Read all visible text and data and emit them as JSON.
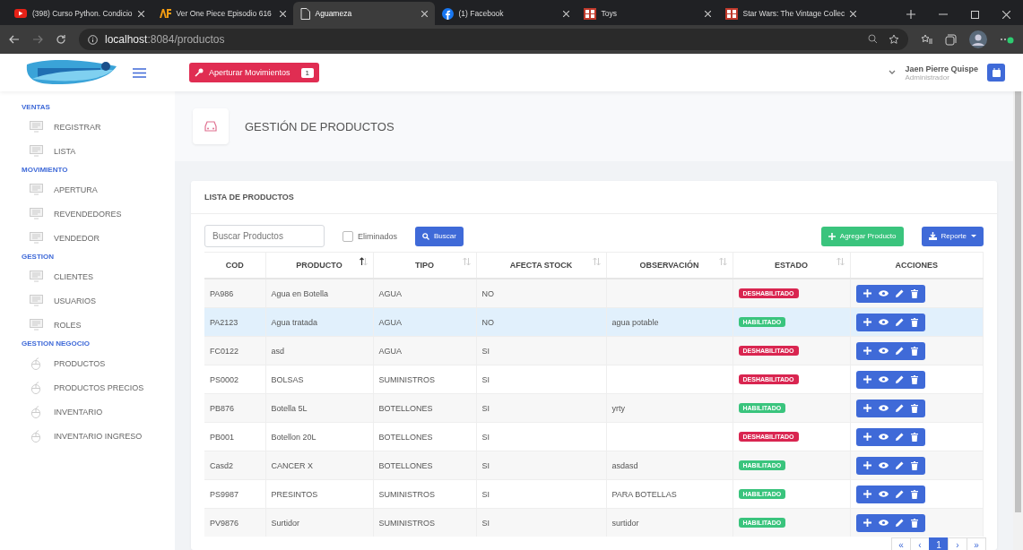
{
  "browser": {
    "tabs": [
      {
        "title": "(398) Curso Python. Condicio",
        "selected": false
      },
      {
        "title": "Ver One Piece Episodio 616",
        "selected": false
      },
      {
        "title": "Aguameza",
        "selected": true
      },
      {
        "title": "(1) Facebook",
        "selected": false
      },
      {
        "title": "Toys",
        "selected": false
      },
      {
        "title": "Star Wars: The Vintage Collec",
        "selected": false
      }
    ],
    "url_host": "localhost",
    "url_rest": ":8084/productos"
  },
  "header": {
    "apertura_button": {
      "label": "Aperturar Movimientos",
      "badge": "1"
    },
    "user": {
      "name": "Jaen Pierre Quispe",
      "role": "Administrador"
    }
  },
  "sidebar": {
    "sections": [
      {
        "title": "VENTAS",
        "items": [
          {
            "label": "REGISTRAR"
          },
          {
            "label": "LISTA"
          }
        ]
      },
      {
        "title": "MOVIMIENTO",
        "items": [
          {
            "label": "APERTURA"
          },
          {
            "label": "REVENDEDORES"
          },
          {
            "label": "VENDEDOR"
          }
        ]
      },
      {
        "title": "GESTION",
        "items": [
          {
            "label": "CLIENTES"
          },
          {
            "label": "USUARIOS"
          },
          {
            "label": "ROLES"
          }
        ]
      },
      {
        "title": "GESTION NEGOCIO",
        "items": [
          {
            "label": "PRODUCTOS"
          },
          {
            "label": "PRODUCTOS PRECIOS"
          },
          {
            "label": "INVENTARIO"
          },
          {
            "label": "INVENTARIO INGRESO"
          }
        ]
      }
    ]
  },
  "page_title": "GESTIÓN DE PRODUCTOS",
  "card": {
    "title": "LISTA DE PRODUCTOS",
    "search": {
      "placeholder": "Buscar Productos"
    },
    "eliminados": {
      "label": "Eliminados",
      "checked": false
    },
    "search_button": "Buscar",
    "add_button": "Agregar Producto",
    "report_button": "Reporte",
    "table": {
      "columns": [
        {
          "label": "COD",
          "sortable": false,
          "sorted": false
        },
        {
          "label": "PRODUCTO",
          "sortable": true,
          "sorted": true
        },
        {
          "label": "TIPO",
          "sortable": true,
          "sorted": false
        },
        {
          "label": "AFECTA STOCK",
          "sortable": true,
          "sorted": false
        },
        {
          "label": "OBSERVACIÓN",
          "sortable": true,
          "sorted": false
        },
        {
          "label": "ESTADO",
          "sortable": true,
          "sorted": false
        },
        {
          "label": "ACCIONES",
          "sortable": false,
          "sorted": false
        }
      ],
      "rows": [
        {
          "cod": "PA986",
          "producto": "Agua en Botella",
          "tipo": "AGUA",
          "afecta_stock": "NO",
          "observacion": "",
          "estado": {
            "label": "DESHABILITADO",
            "kind": "disabled"
          },
          "selected": false
        },
        {
          "cod": "PA2123",
          "producto": "Agua tratada",
          "tipo": "AGUA",
          "afecta_stock": "NO",
          "observacion": "agua potable",
          "estado": {
            "label": "HABILITADO",
            "kind": "enabled"
          },
          "selected": true
        },
        {
          "cod": "FC0122",
          "producto": "asd",
          "tipo": "AGUA",
          "afecta_stock": "SI",
          "observacion": "",
          "estado": {
            "label": "DESHABILITADO",
            "kind": "disabled"
          },
          "selected": false
        },
        {
          "cod": "PS0002",
          "producto": "BOLSAS",
          "tipo": "SUMINISTROS",
          "afecta_stock": "SI",
          "observacion": "",
          "estado": {
            "label": "DESHABILITADO",
            "kind": "disabled"
          },
          "selected": false
        },
        {
          "cod": "PB876",
          "producto": "Botella 5L",
          "tipo": "BOTELLONES",
          "afecta_stock": "SI",
          "observacion": "yrty",
          "estado": {
            "label": "HABILITADO",
            "kind": "enabled"
          },
          "selected": false
        },
        {
          "cod": "PB001",
          "producto": "Botellon 20L",
          "tipo": "BOTELLONES",
          "afecta_stock": "SI",
          "observacion": "",
          "estado": {
            "label": "DESHABILITADO",
            "kind": "disabled"
          },
          "selected": false
        },
        {
          "cod": "Casd2",
          "producto": "CANCER X",
          "tipo": "BOTELLONES",
          "afecta_stock": "SI",
          "observacion": "asdasd",
          "estado": {
            "label": "HABILITADO",
            "kind": "enabled"
          },
          "selected": false
        },
        {
          "cod": "PS9987",
          "producto": "PRESINTOS",
          "tipo": "SUMINISTROS",
          "afecta_stock": "SI",
          "observacion": "PARA BOTELLAS",
          "estado": {
            "label": "HABILITADO",
            "kind": "enabled"
          },
          "selected": false
        },
        {
          "cod": "PV9876",
          "producto": "Surtidor",
          "tipo": "SUMINISTROS",
          "afecta_stock": "SI",
          "observacion": "surtidor",
          "estado": {
            "label": "HABILITADO",
            "kind": "enabled"
          },
          "selected": false
        }
      ]
    },
    "pagination": [
      {
        "label": "«",
        "selected": false
      },
      {
        "label": "‹",
        "selected": false
      },
      {
        "label": "1",
        "selected": true
      },
      {
        "label": "›",
        "selected": false
      },
      {
        "label": "»",
        "selected": false
      }
    ]
  }
}
